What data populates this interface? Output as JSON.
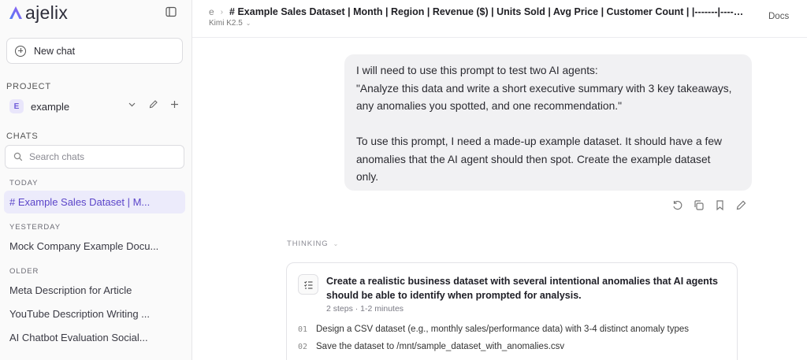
{
  "app": {
    "name": "ajelix"
  },
  "sidebar": {
    "new_chat_label": "New chat",
    "project_label": "PROJECT",
    "project": {
      "badge": "E",
      "name": "example"
    },
    "chats_label": "CHATS",
    "search_placeholder": "Search chats",
    "groups": [
      {
        "label": "TODAY",
        "items": [
          "# Example Sales Dataset | M..."
        ]
      },
      {
        "label": "YESTERDAY",
        "items": [
          "Mock Company Example Docu..."
        ]
      },
      {
        "label": "OLDER",
        "items": [
          "Meta Description for Article",
          "YouTube Description Writing ...",
          "AI Chatbot Evaluation Social..."
        ]
      }
    ]
  },
  "header": {
    "breadcrumb_project": "e",
    "title": "# Example Sales Dataset | Month | Region | Revenue ($) | Units Sold | Avg Price | Customer Count | |-------|---------|-----------|",
    "model": "Kimi K2.5",
    "docs_label": "Docs"
  },
  "message": {
    "lines": [
      "I will need to use this prompt to test two AI agents:",
      "\"Analyze this data and write a short executive summary with 3 key takeaways,",
      "any anomalies you spotted, and one recommendation.\"",
      "",
      "To use this prompt, I need a made-up example dataset. It should have a few",
      "anomalies that the AI agent should then spot. Create the example dataset",
      "only."
    ]
  },
  "thinking_label": "THINKING",
  "plan": {
    "title": "Create a realistic business dataset with several intentional anomalies that AI agents should be able to identify when prompted for analysis.",
    "meta": "2 steps · 1-2 minutes",
    "steps": [
      {
        "num": "01",
        "text": "Design a CSV dataset (e.g., monthly sales/performance data) with 3-4 distinct anomaly types"
      },
      {
        "num": "02",
        "text": "Save the dataset to /mnt/sample_dataset_with_anomalies.csv"
      }
    ]
  },
  "colors": {
    "accent": "#6f5bd9",
    "active_bg": "#ecebfb",
    "bubble_bg": "#f1f1f3"
  }
}
